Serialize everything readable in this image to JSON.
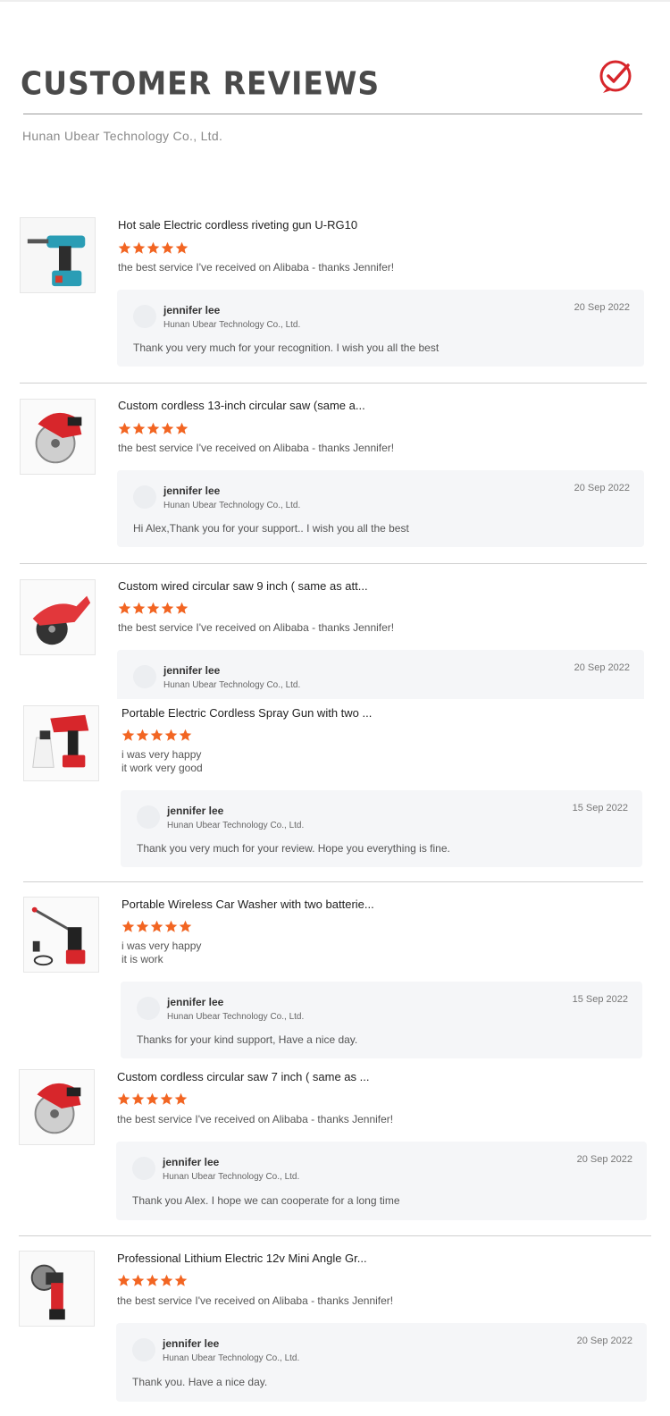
{
  "header": {
    "title": "CUSTOMER REVIEWS",
    "company": "Hunan Ubear Technology Co., Ltd.",
    "icon": "check-circle-icon",
    "accent": "#d7262b"
  },
  "star_color": "#f26522",
  "reviews": [
    {
      "product_title": "Hot sale Electric cordless riveting gun U-RG10",
      "product_image": "riveting-gun-image",
      "rating": 5,
      "comment": "the best service I've received on Alibaba - thanks Jennifer!",
      "reply": {
        "name": "jennifer lee",
        "company": "Hunan Ubear Technology Co., Ltd.",
        "date": "20 Sep 2022",
        "text": "Thank you very much for your recognition. I wish you all the best"
      }
    },
    {
      "product_title": "Custom cordless 13-inch circular saw (same a...",
      "product_image": "circular-saw-image",
      "rating": 5,
      "comment": "the best service I've received on Alibaba - thanks Jennifer!",
      "reply": {
        "name": "jennifer lee",
        "company": "Hunan Ubear Technology Co., Ltd.",
        "date": "20 Sep 2022",
        "text": "Hi Alex,Thank you for your support.. I wish you all the best"
      }
    },
    {
      "product_title": "Custom wired circular saw 9 inch ( same as att...",
      "product_image": "wired-circular-saw-image",
      "rating": 5,
      "comment": "the best service I've received on Alibaba - thanks Jennifer!",
      "reply": {
        "name": "jennifer lee",
        "company": "Hunan Ubear Technology Co., Ltd.",
        "date": "20 Sep 2022",
        "text": ""
      }
    },
    {
      "product_title": "Portable Electric Cordless Spray Gun with two ...",
      "product_image": "spray-gun-image",
      "rating": 5,
      "comment": "i was very happy\nit work very good",
      "reply": {
        "name": "jennifer lee",
        "company": "Hunan Ubear Technology Co., Ltd.",
        "date": "15 Sep 2022",
        "text": "Thank you very much for your review. Hope you everything is fine."
      }
    },
    {
      "product_title": "Portable Wireless Car Washer with two batterie...",
      "product_image": "car-washer-image",
      "rating": 5,
      "comment": "i was very happy\nit is work",
      "reply": {
        "name": "jennifer lee",
        "company": "Hunan Ubear Technology Co., Ltd.",
        "date": "15 Sep 2022",
        "text": "Thanks for your kind support, Have a nice day."
      }
    },
    {
      "product_title": "Custom cordless circular saw 7 inch ( same as ...",
      "product_image": "circular-saw-7-image",
      "rating": 5,
      "comment": "the best service I've received on Alibaba - thanks Jennifer!",
      "reply": {
        "name": "jennifer lee",
        "company": "Hunan Ubear Technology Co., Ltd.",
        "date": "20 Sep 2022",
        "text": "Thank you Alex. I hope we can cooperate for a long time"
      }
    },
    {
      "product_title": "Professional Lithium Electric 12v Mini Angle Gr...",
      "product_image": "angle-grinder-image",
      "rating": 5,
      "comment": "the best service I've received on Alibaba - thanks Jennifer!",
      "reply": {
        "name": "jennifer lee",
        "company": "Hunan Ubear Technology Co., Ltd.",
        "date": "20 Sep 2022",
        "text": "Thank you.  Have a nice day."
      }
    }
  ]
}
